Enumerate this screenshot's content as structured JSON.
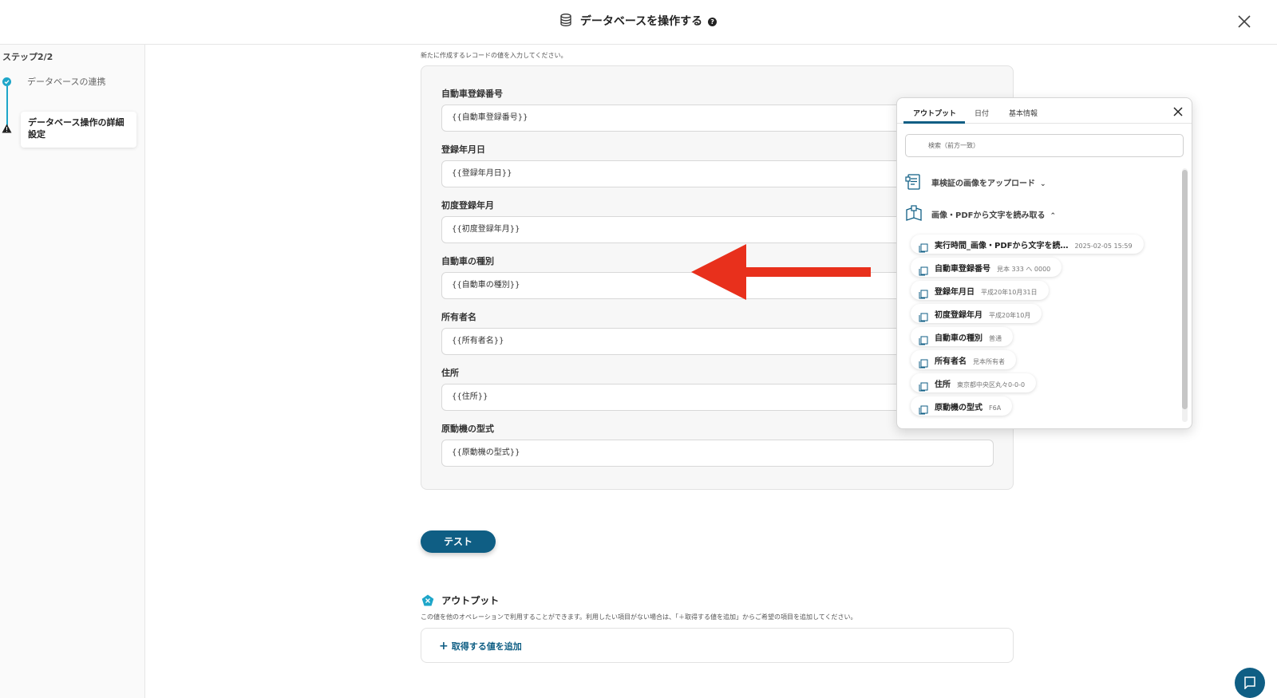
{
  "header": {
    "title": "データベースを操作する",
    "help_icon": "help-icon",
    "close_icon": "close-icon"
  },
  "sidebar": {
    "step_label": "ステップ2/2",
    "steps": [
      {
        "label": "データベースの連携",
        "status": "done"
      },
      {
        "label": "データベース操作の詳細設定",
        "status": "warning"
      }
    ]
  },
  "form": {
    "hint": "新たに作成するレコードの値を入力してください。",
    "fields": [
      {
        "label": "自動車登録番号",
        "value": "{{自動車登録番号}}"
      },
      {
        "label": "登録年月日",
        "value": "{{登録年月日}}"
      },
      {
        "label": "初度登録年月",
        "value": "{{初度登録年月}}"
      },
      {
        "label": "自動車の種別",
        "value": "{{自動車の種別}}"
      },
      {
        "label": "所有者名",
        "value": "{{所有者名}}"
      },
      {
        "label": "住所",
        "value": "{{住所}}"
      },
      {
        "label": "原動機の型式",
        "value": "{{原動機の型式}}"
      }
    ]
  },
  "test_button": "テスト",
  "output": {
    "heading": "アウトプット",
    "description": "この値を他のオペレーションで利用することができます。利用したい項目がない場合は、「＋取得する値を追加」からご希望の項目を追加してください。",
    "add_plus": "+",
    "add_label": "取得する値を追加"
  },
  "popup": {
    "tabs": [
      "アウトプット",
      "日付",
      "基本情報"
    ],
    "active_tab": "アウトプット",
    "search_placeholder": "検索（前方一致）",
    "sections": [
      {
        "label": "車検証の画像をアップロード",
        "chevron": "⌄",
        "expanded": false
      },
      {
        "label": "画像・PDFから文字を読み取る",
        "chevron": "⌃",
        "expanded": true
      }
    ],
    "items": [
      {
        "name": "実行時間_画像・PDFから文字を読…",
        "value": "2025-02-05 15:59"
      },
      {
        "name": "自動車登録番号",
        "value": "見本 333 へ 0000"
      },
      {
        "name": "登録年月日",
        "value": "平成20年10月31日"
      },
      {
        "name": "初度登録年月",
        "value": "平成20年10月"
      },
      {
        "name": "自動車の種別",
        "value": "普通"
      },
      {
        "name": "所有者名",
        "value": "見本所有者"
      },
      {
        "name": "住所",
        "value": "東京都中央区丸々0-0-0"
      },
      {
        "name": "原動機の型式",
        "value": "F6A"
      }
    ]
  },
  "colors": {
    "accent": "#0f5e84",
    "step_done": "#1ea6c9",
    "arrow": "#e8301c"
  }
}
